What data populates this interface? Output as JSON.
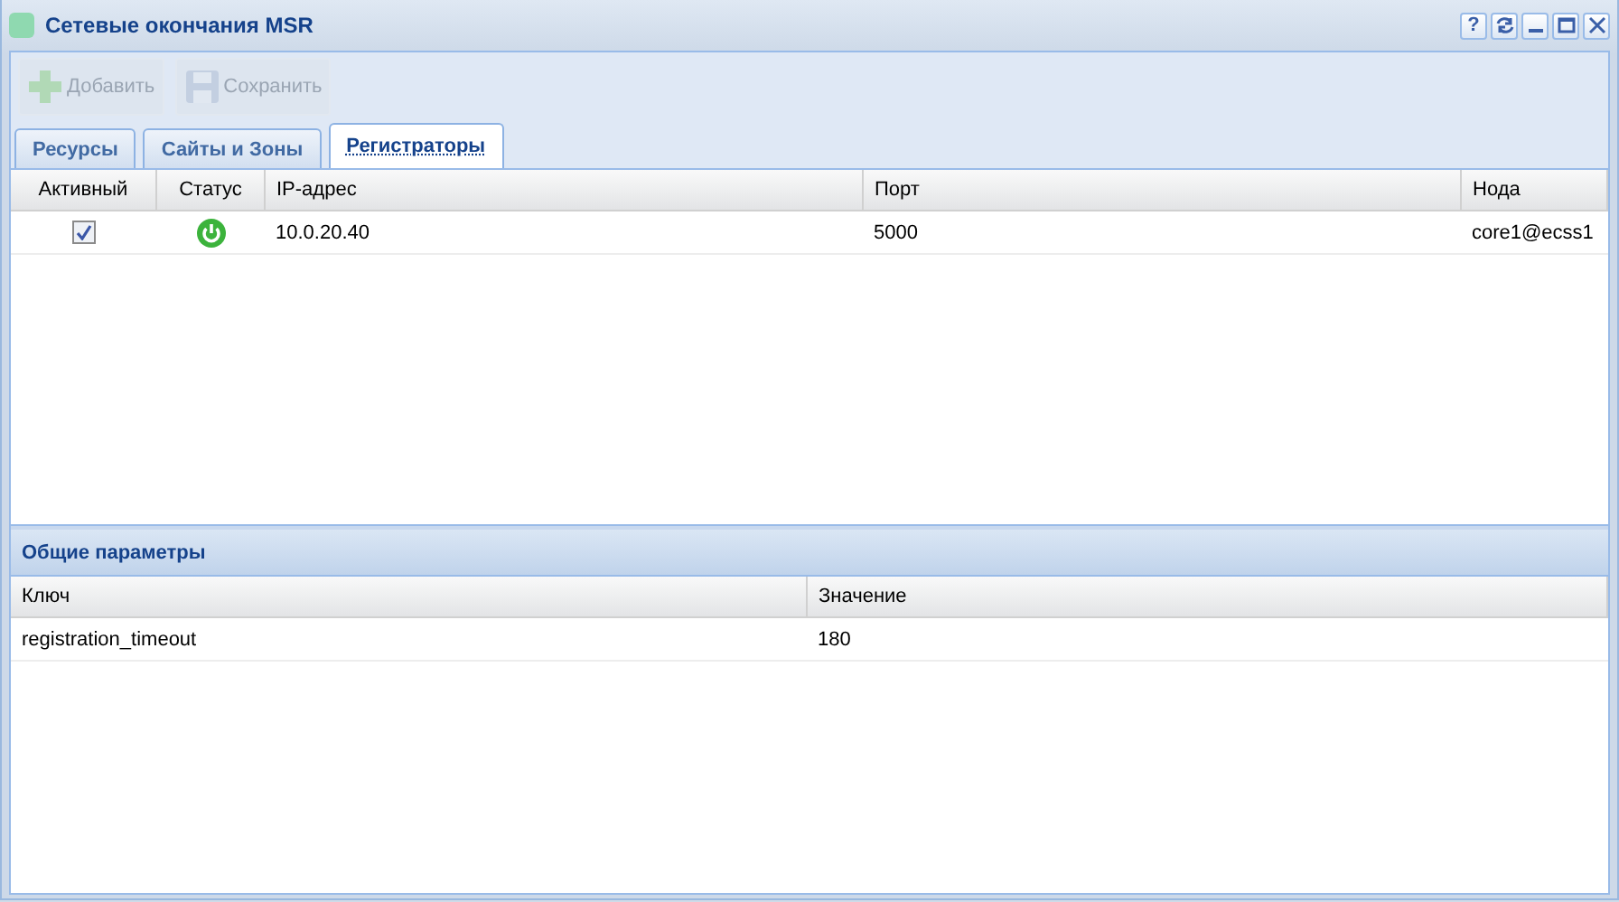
{
  "window": {
    "title": "Сетевые окончания MSR",
    "controls": [
      {
        "kind": "help",
        "label": "?"
      },
      {
        "kind": "refresh"
      },
      {
        "kind": "minimize"
      },
      {
        "kind": "maximize"
      },
      {
        "kind": "close"
      }
    ]
  },
  "toolbar": [
    {
      "kind": "add",
      "label": "Добавить",
      "disabled": true
    },
    {
      "kind": "save",
      "label": "Сохранить",
      "disabled": true
    }
  ],
  "tabs": [
    {
      "label": "Ресурсы",
      "selected": false
    },
    {
      "label": "Сайты и Зоны",
      "selected": false
    },
    {
      "label": "Регистраторы",
      "selected": true
    }
  ],
  "registrars": {
    "columns": [
      "Активный",
      "Статус",
      "IP-адрес",
      "Порт",
      "Нода"
    ],
    "rows": [
      {
        "active": true,
        "online": true,
        "ip": "10.0.20.40",
        "port": "5000",
        "node": "core1@ecss1"
      }
    ]
  },
  "general": {
    "title": "Общие параметры",
    "columns": [
      "Ключ",
      "Значение"
    ],
    "rows": [
      {
        "key": "registration_timeout",
        "value": "180"
      }
    ]
  }
}
